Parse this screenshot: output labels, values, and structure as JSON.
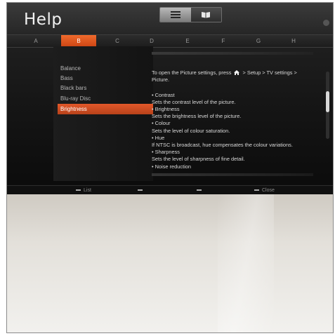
{
  "header": {
    "title": "Help"
  },
  "view_toggle": {
    "list_icon": "list-icon",
    "book_icon": "book-icon"
  },
  "alphabet": [
    "A",
    "B",
    "C",
    "D",
    "E",
    "F",
    "G",
    "H"
  ],
  "alphabet_active": "B",
  "topics": [
    {
      "label": "Balance",
      "selected": false
    },
    {
      "label": "Bass",
      "selected": false
    },
    {
      "label": "Black bars",
      "selected": false
    },
    {
      "label": "Blu-ray Disc",
      "selected": false
    },
    {
      "label": "Brightness",
      "selected": true
    }
  ],
  "content": {
    "intro_a": "To open the Picture settings, press",
    "intro_home_icon": "home-icon",
    "intro_b": "> Setup > TV settings >",
    "intro_c": "Picture.",
    "lines": [
      {
        "text": "• Contrast",
        "bold": false
      },
      {
        "text": "Sets the contrast level of the picture.",
        "bold": false
      },
      {
        "text": "• Brightness",
        "bold": false
      },
      {
        "text": "Sets the brightness level of the picture.",
        "bold": false
      },
      {
        "text": "• Colour",
        "bold": false
      },
      {
        "text": "Sets the level of colour saturation.",
        "bold": false
      },
      {
        "text": "• Hue",
        "bold": false
      },
      {
        "text": "If NTSC is broadcast, hue compensates the colour variations.",
        "bold": false
      },
      {
        "text": "• Sharpness",
        "bold": false
      },
      {
        "text": "Sets the level of sharpness of fine detail.",
        "bold": false
      },
      {
        "text": "• Noise reduction",
        "bold": false
      }
    ]
  },
  "footer": {
    "list_label": "List",
    "close_label": "Close"
  },
  "colors": {
    "accent": "#e2582a",
    "screen_bg": "#151515",
    "text": "#d8d8d8"
  }
}
